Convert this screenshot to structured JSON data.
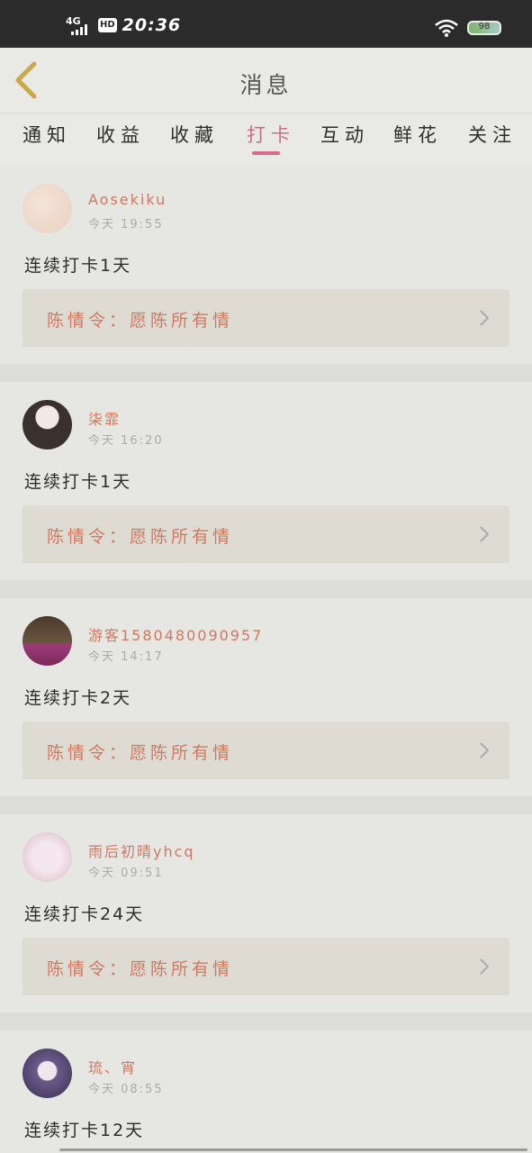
{
  "status_bar": {
    "network": "4G",
    "hd": "HD",
    "time": "20:36",
    "battery": "98"
  },
  "header": {
    "title": "消息"
  },
  "tabs": [
    {
      "label": "通知",
      "active": false
    },
    {
      "label": "收益",
      "active": false
    },
    {
      "label": "收藏",
      "active": false
    },
    {
      "label": "打卡",
      "active": true
    },
    {
      "label": "互动",
      "active": false
    },
    {
      "label": "鲜花",
      "active": false
    },
    {
      "label": "关注",
      "active": false
    }
  ],
  "colors": {
    "accent": "#d86a90",
    "name": "#d07860",
    "background": "#e6e6e3"
  },
  "checkins": [
    {
      "user": "Aosekiku",
      "time": "今天 19:55",
      "text": "连续打卡1天",
      "drama": "陈情令：愿陈所有情"
    },
    {
      "user": "柒霏",
      "time": "今天 16:20",
      "text": "连续打卡1天",
      "drama": "陈情令：愿陈所有情"
    },
    {
      "user": "游客1580480090957",
      "time": "今天 14:17",
      "text": "连续打卡2天",
      "drama": "陈情令：愿陈所有情"
    },
    {
      "user": "雨后初晴yhcq",
      "time": "今天 09:51",
      "text": "连续打卡24天",
      "drama": "陈情令：愿陈所有情"
    },
    {
      "user": "琉、宵",
      "time": "今天 08:55",
      "text": "连续打卡12天",
      "drama": ""
    }
  ]
}
